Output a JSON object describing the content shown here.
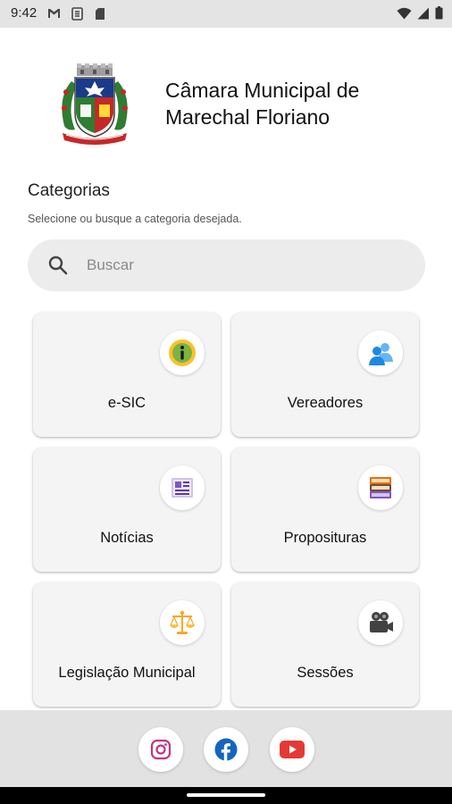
{
  "status_bar": {
    "time": "9:42",
    "notification_icons": [
      "gmail-icon",
      "sync-icon",
      "sd-card-icon"
    ],
    "right_icons": [
      "wifi-icon",
      "signal-icon",
      "battery-icon"
    ]
  },
  "header": {
    "crest_icon": "municipal-crest-icon",
    "title": "Câmara Municipal de Marechal Floriano"
  },
  "categories": {
    "title": "Categorias",
    "subtitle": "Selecione ou busque a categoria desejada."
  },
  "search": {
    "placeholder": "Buscar",
    "value": ""
  },
  "cards": [
    {
      "label": "e-SIC",
      "icon": "info-icon"
    },
    {
      "label": "Vereadores",
      "icon": "people-icon"
    },
    {
      "label": "Notícias",
      "icon": "newspaper-icon"
    },
    {
      "label": "Proposituras",
      "icon": "books-icon"
    },
    {
      "label": "Legislação Municipal",
      "icon": "scales-icon"
    },
    {
      "label": "Sessões",
      "icon": "video-camera-icon"
    }
  ],
  "social": [
    {
      "name": "Instagram",
      "icon": "instagram-icon",
      "color": "#c13584"
    },
    {
      "name": "Facebook",
      "icon": "facebook-icon",
      "color": "#1565c0"
    },
    {
      "name": "YouTube",
      "icon": "youtube-icon",
      "color": "#e53935"
    }
  ],
  "colors": {
    "status_bar": "#e4e4e4",
    "search_bg": "#ececec",
    "card_bg": "#f4f4f4",
    "bottom_bar": "#e2e2e2"
  }
}
